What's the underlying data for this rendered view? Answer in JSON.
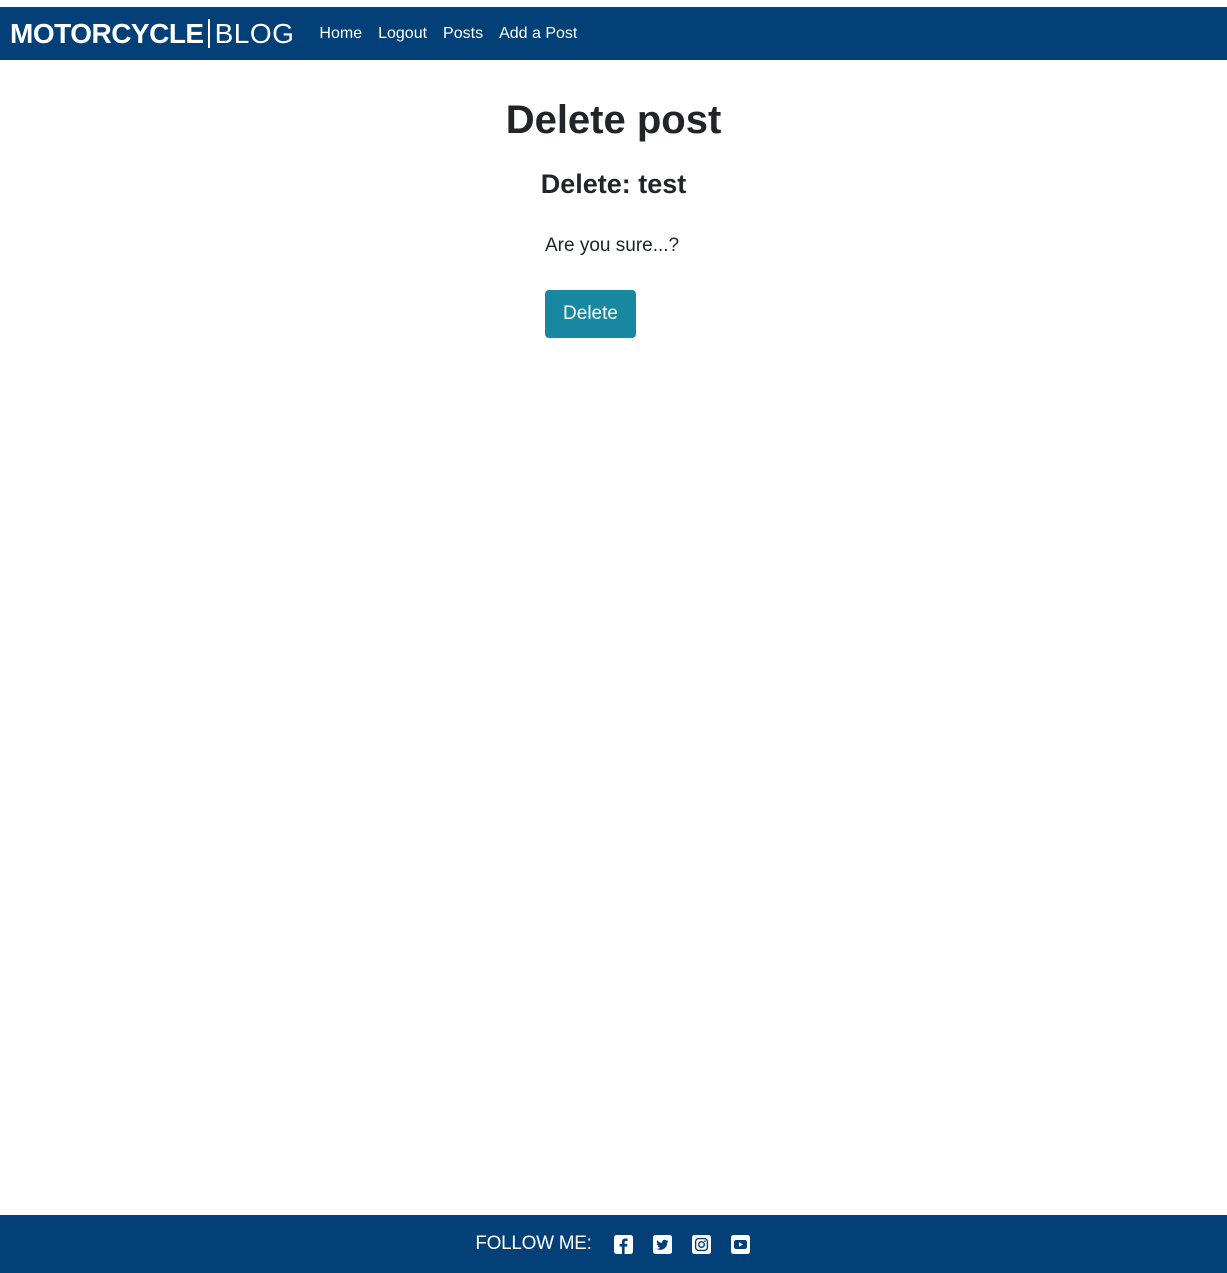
{
  "navbar": {
    "brand_bold": "MOTORCYCLE",
    "brand_light": "BLOG",
    "links": [
      {
        "label": "Home"
      },
      {
        "label": "Logout"
      },
      {
        "label": "Posts"
      },
      {
        "label": "Add a Post"
      }
    ]
  },
  "main": {
    "title": "Delete post",
    "subtitle": "Delete: test",
    "confirm_text": "Are you sure...?",
    "delete_label": "Delete"
  },
  "footer": {
    "follow_label": "FOLLOW ME:",
    "social_icons": [
      "facebook-icon",
      "twitter-icon",
      "instagram-icon",
      "youtube-icon"
    ]
  },
  "colors": {
    "navbar_bg": "#024077",
    "button_bg": "#1888a1",
    "text": "#212529"
  }
}
